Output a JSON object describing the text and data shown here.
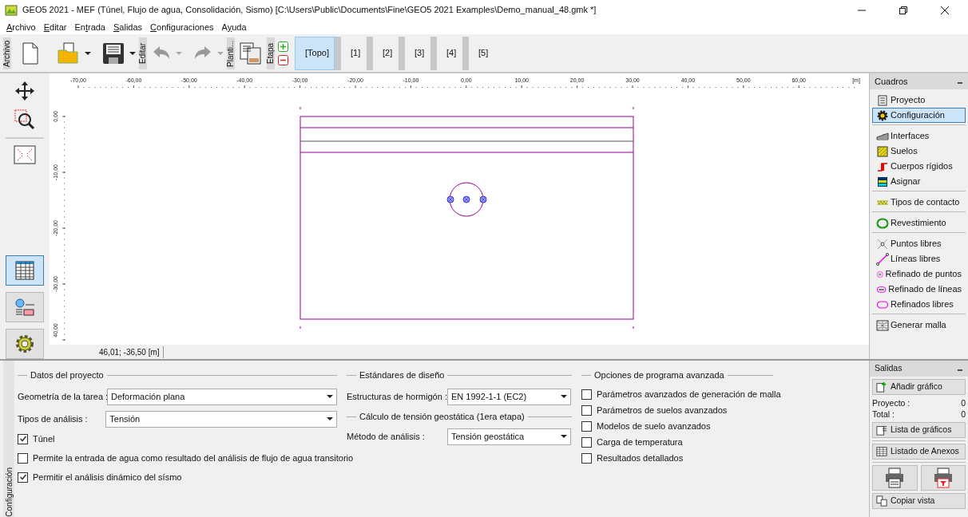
{
  "window": {
    "title": "GEO5 2021 - MEF (Túnel, Flujo de agua, Consolidación, Sismo) [C:\\Users\\Public\\Documents\\Fine\\GEO5 2021 Examples\\Demo_manual_48.gmk *]"
  },
  "menu": [
    {
      "key": "A",
      "after": "rchivo"
    },
    {
      "key": "E",
      "after": "ditar"
    },
    {
      "before": "En",
      "key": "t",
      "after": "rada"
    },
    {
      "key": "S",
      "after": "alidas"
    },
    {
      "key": "C",
      "after": "onfiguraciones"
    },
    {
      "before": "A",
      "key": "y",
      "after": "uda"
    }
  ],
  "toolbar": {
    "sections": [
      "Archivo",
      "Editar",
      "Planti...",
      "Etapa"
    ],
    "stages": [
      {
        "label": "[Topo]",
        "selected": true
      },
      {
        "label": "[1]",
        "selected": false
      },
      {
        "label": "[2]",
        "selected": false
      },
      {
        "label": "[3]",
        "selected": false
      },
      {
        "label": "[4]",
        "selected": false
      },
      {
        "label": "[5]",
        "selected": false
      }
    ]
  },
  "left_tools": [
    {
      "selected": true
    },
    {
      "selected": false
    },
    {
      "selected": false
    }
  ],
  "canvas": {
    "x_ticks": [
      "-70,00",
      "-60,00",
      "-50,00",
      "-40,00",
      "-30,00",
      "-20,00",
      "-10,00",
      "0,00",
      "10,00",
      "20,00",
      "30,00",
      "40,00",
      "50,00",
      "60,00"
    ],
    "x_unit": "[m]",
    "y_ticks": [
      "0,00",
      "-10,00",
      "-20,00",
      "-30,00",
      "40,00"
    ],
    "cursor": "46,01; -36,50 [m]"
  },
  "cuadros": {
    "title": "Cuadros",
    "groups": [
      [
        {
          "label": "Proyecto",
          "selected": false
        },
        {
          "label": "Configuración",
          "selected": true
        }
      ],
      [
        {
          "label": "Interfaces",
          "selected": false
        },
        {
          "label": "Suelos",
          "selected": false
        },
        {
          "label": "Cuerpos rígidos",
          "selected": false
        },
        {
          "label": "Asignar",
          "selected": false
        }
      ],
      [
        {
          "label": "Tipos de contacto",
          "selected": false
        }
      ],
      [
        {
          "label": "Revestimiento",
          "selected": false
        }
      ],
      [
        {
          "label": "Puntos libres",
          "selected": false
        },
        {
          "label": "Líneas libres",
          "selected": false
        },
        {
          "label": "Refinado de puntos",
          "selected": false
        },
        {
          "label": "Refinado de líneas",
          "selected": false
        },
        {
          "label": "Refinados libres",
          "selected": false
        }
      ],
      [
        {
          "label": "Generar malla",
          "selected": false
        }
      ]
    ]
  },
  "salidas": {
    "title": "Salidas",
    "add": "Añadir gráfico",
    "stats": [
      {
        "label": "Proyecto :",
        "value": "0"
      },
      {
        "label": "Total :",
        "value": "0"
      }
    ],
    "list": "Lista de gráficos",
    "annex": "Listado de Anexos",
    "copy": "Copiar vista"
  },
  "config": {
    "tab": "Configuración",
    "project": {
      "title": "Datos del proyecto",
      "fields": [
        {
          "label": "Geometría de la tarea :",
          "value": "Deformación plana"
        },
        {
          "label": "Tipos de análisis :",
          "value": "Tensión"
        }
      ],
      "options": [
        {
          "label": "Túnel",
          "checked": true
        },
        {
          "label": "Permite la entrada de agua como resultado del análisis de flujo de agua transitorio",
          "checked": false
        },
        {
          "label": "Permitir el análisis dinámico del sísmo",
          "checked": true
        }
      ]
    },
    "design": {
      "title": "Estándares de diseño",
      "field": {
        "label": "Estructuras de hormigón :",
        "value": "EN 1992-1-1 (EC2)"
      },
      "sub_title": "Cálculo de tensión geostática (1era etapa)",
      "sub_field": {
        "label": "Método de análisis :",
        "value": "Tensión geostática"
      }
    },
    "advanced": {
      "title": "Opciones de programa avanzada",
      "options": [
        {
          "label": "Parámetros avanzados de generación de malla",
          "checked": false
        },
        {
          "label": "Parámetros de suelos avanzados",
          "checked": false
        },
        {
          "label": "Modelos de suelo avanzados",
          "checked": false
        },
        {
          "label": "Carga de temperatura",
          "checked": false
        },
        {
          "label": "Resultados detallados",
          "checked": false
        }
      ]
    }
  }
}
